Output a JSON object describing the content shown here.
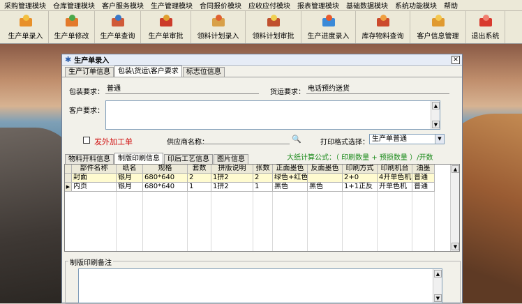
{
  "menubar": {
    "items": [
      "采购管理模块",
      "仓库管理模块",
      "客户服务模块",
      "生产管理模块",
      "合同报价模块",
      "应收应付模块",
      "报表管理模块",
      "基础数据模块",
      "系统功能模块",
      "帮助"
    ]
  },
  "toolbar": {
    "buttons": [
      {
        "label": "生产单录入",
        "icon": "order-entry-icon",
        "c1": "#e8902a",
        "c2": "#f2c040"
      },
      {
        "label": "生产单修改",
        "icon": "order-edit-icon",
        "c1": "#e37a2c",
        "c2": "#4aa84a"
      },
      {
        "label": "生产单查询",
        "icon": "order-search-icon",
        "c1": "#d05a38",
        "c2": "#3a78c8"
      },
      {
        "label": "生产单审批",
        "icon": "order-approve-icon",
        "c1": "#cc3b2a",
        "c2": "#e0a030"
      },
      {
        "label": "领料计划录入",
        "icon": "material-plan-icon",
        "c1": "#d8a048",
        "c2": "#e06030"
      },
      {
        "label": "领料计划审批",
        "icon": "plan-approve-icon",
        "c1": "#c0502e",
        "c2": "#f0d050"
      },
      {
        "label": "生产进度录入",
        "icon": "progress-chart-icon",
        "c1": "#3a8ad8",
        "c2": "#e85a2c"
      },
      {
        "label": "库存物料查询",
        "icon": "inventory-icon",
        "c1": "#cc4a2c",
        "c2": "#f0a040"
      },
      {
        "label": "客户信息管理",
        "icon": "customer-icon",
        "c1": "#e09a30",
        "c2": "#f4c850"
      },
      {
        "label": "退出系统",
        "icon": "exit-icon",
        "c1": "#d83a2e",
        "c2": "#f08070"
      }
    ]
  },
  "window": {
    "title": "生产单录入",
    "close_glyph": "✕",
    "tabs": [
      "生产订单信息",
      "包装\\货运\\客户要求",
      "标志位信息"
    ],
    "packaging_label": "包装要求：",
    "packaging_value": "普通",
    "shipping_label": "货运要求：",
    "shipping_value": "电话预约送货",
    "customer_req_label": "客户要求：",
    "outsource_label": "发外加工单",
    "supplier_label": "供应商名称：",
    "print_format_label": "打印格式选择：",
    "print_format_value": "生产单普通",
    "lower_tabs": [
      "物料开料信息",
      "制版印刷信息",
      "印后工艺信息",
      "图片信息"
    ],
    "formula": "大纸计算公式：（ 印刷数量 + 预损数量 ）/开数",
    "grid": {
      "headers": [
        "部件名称",
        "纸名",
        "规格",
        "套数",
        "拼版说明",
        "张数",
        "正面墨色",
        "反面墨色",
        "印刷方式",
        "印刷机台",
        "油墨"
      ],
      "rows": [
        [
          "封面",
          "银月",
          "680*640",
          "2",
          "1拼2",
          "2",
          "绿色+红色",
          "",
          "2+0",
          "4开单色机",
          "普通"
        ],
        [
          "内页",
          "银月",
          "680*640",
          "1",
          "1拼2",
          "1",
          "黑色",
          "黑色",
          "1+1正反",
          "开单色机",
          "普通"
        ]
      ]
    },
    "remark_label": "制版印刷备注"
  }
}
